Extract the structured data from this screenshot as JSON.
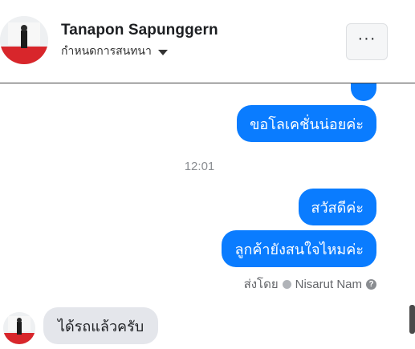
{
  "header": {
    "contact_name": "Tanapon Sapunggern",
    "subtitle": "กำหนดการสนทนา"
  },
  "messages": {
    "outgoing_1": "ขอโลเคชั่นน่อยค่ะ",
    "timestamp": "12:01",
    "outgoing_2": "สวัสดีค่ะ",
    "outgoing_3": "ลูกค้ายังสนใจไหมค่ะ",
    "sent_by_prefix": "ส่งโดย",
    "sent_by_name": "Nisarut Nam",
    "incoming_1": "ได้รถแล้วครับ"
  },
  "colors": {
    "outgoing_bubble": "#0a7cff",
    "incoming_bubble": "#e4e6eb"
  }
}
